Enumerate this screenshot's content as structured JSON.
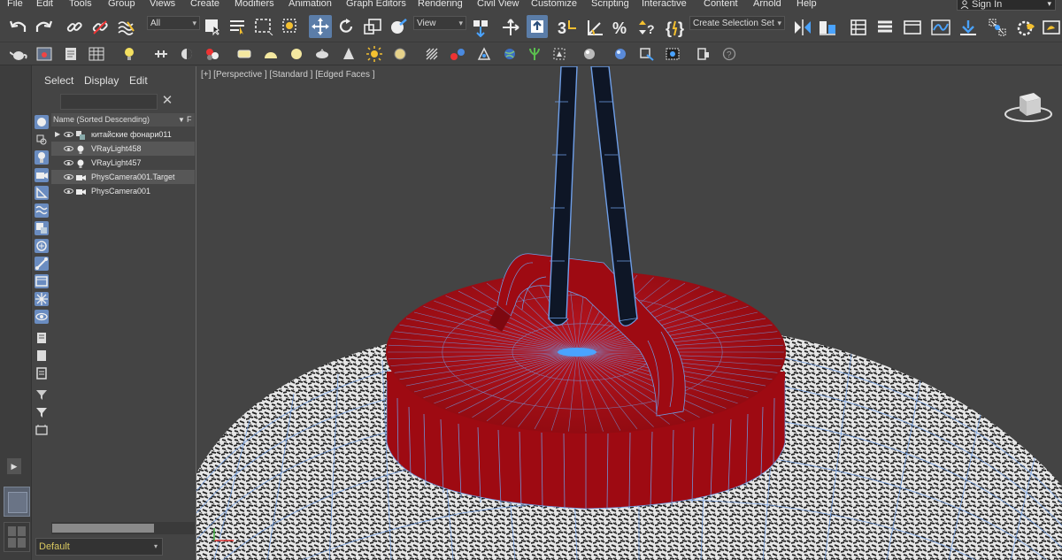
{
  "menu": {
    "items": [
      "File",
      "Edit",
      "Tools",
      "Group",
      "Views",
      "Create",
      "Modifiers",
      "Animation",
      "Graph Editors",
      "Rendering",
      "Civil View",
      "Customize",
      "Scripting",
      "Interactive",
      "Content",
      "Arnold",
      "Help"
    ],
    "sign_in": "Sign In"
  },
  "toolbar": {
    "filter_selection": "All",
    "reference_coord": "View",
    "named_selection_set": "Create Selection Set"
  },
  "explorer": {
    "tabs": [
      "Select",
      "Display",
      "Edit"
    ],
    "search_value": "",
    "column_header": "Name (Sorted Descending)",
    "column_f": "F",
    "rows": [
      {
        "label": "китайские фонари011",
        "icon": "group-icon",
        "expandable": true,
        "selected": false
      },
      {
        "label": "VRayLight458",
        "icon": "light-bulb-icon",
        "expandable": false,
        "selected": true
      },
      {
        "label": "VRayLight457",
        "icon": "light-bulb-icon",
        "expandable": false,
        "selected": false
      },
      {
        "label": "PhysCamera001.Target",
        "icon": "camera-icon",
        "expandable": false,
        "selected": true
      },
      {
        "label": "PhysCamera001",
        "icon": "camera-icon",
        "expandable": false,
        "selected": false
      }
    ],
    "layer": "Default"
  },
  "viewport": {
    "label": "[+] [Perspective ] [Standard ] [Edged Faces ]"
  },
  "colors": {
    "accent": "#5b7da8",
    "cap": "#9e0a12",
    "wire": "#6f9fe8",
    "layer_text": "#d8c760"
  }
}
